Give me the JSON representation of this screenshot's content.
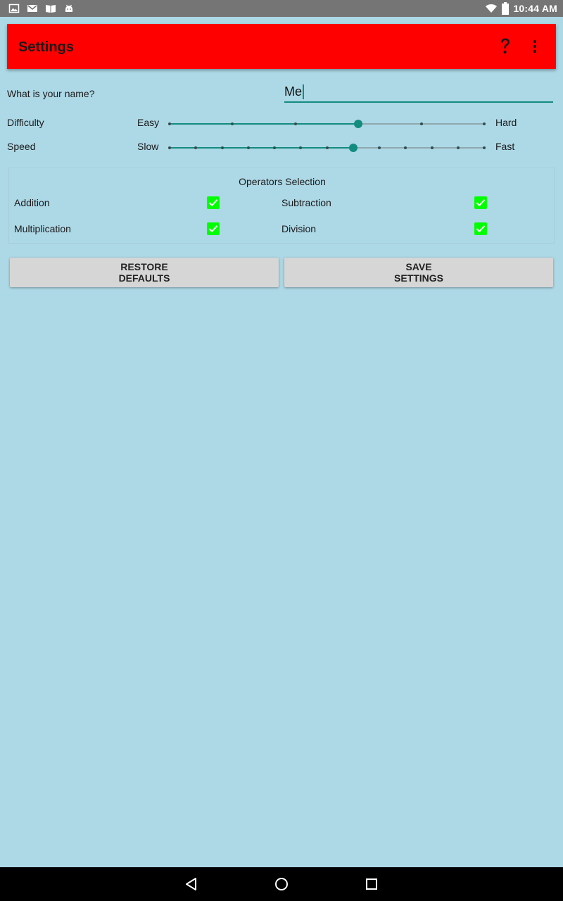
{
  "status_bar": {
    "time": "10:44 AM",
    "left_icons": [
      "image-notification-icon",
      "gmail-icon",
      "book-icon",
      "android-icon"
    ],
    "right_icons": [
      "wifi-icon",
      "battery-icon"
    ]
  },
  "toolbar": {
    "title": "Settings",
    "background": "#ff0000",
    "actions": [
      "help-icon",
      "more-vert-icon"
    ]
  },
  "name": {
    "label": "What is your name?",
    "value": "Me"
  },
  "difficulty": {
    "label": "Difficulty",
    "min_label": "Easy",
    "max_label": "Hard",
    "steps": 6,
    "value_index": 3
  },
  "speed": {
    "label": "Speed",
    "min_label": "Slow",
    "max_label": "Fast",
    "steps": 13,
    "value_index": 7
  },
  "operators": {
    "title": "Operators Selection",
    "items": [
      {
        "label": "Addition",
        "checked": true
      },
      {
        "label": "Subtraction",
        "checked": true
      },
      {
        "label": "Multiplication",
        "checked": true
      },
      {
        "label": "Division",
        "checked": true
      }
    ]
  },
  "buttons": {
    "restore_line1": "RESTORE",
    "restore_line2": "DEFAULTS",
    "save_line1": "SAVE",
    "save_line2": "SETTINGS"
  },
  "colors": {
    "accent": "#128c7e",
    "background": "#add8e6",
    "checkbox": "#00ff00"
  },
  "nav_bar": [
    "back-icon",
    "home-icon",
    "recents-icon"
  ]
}
